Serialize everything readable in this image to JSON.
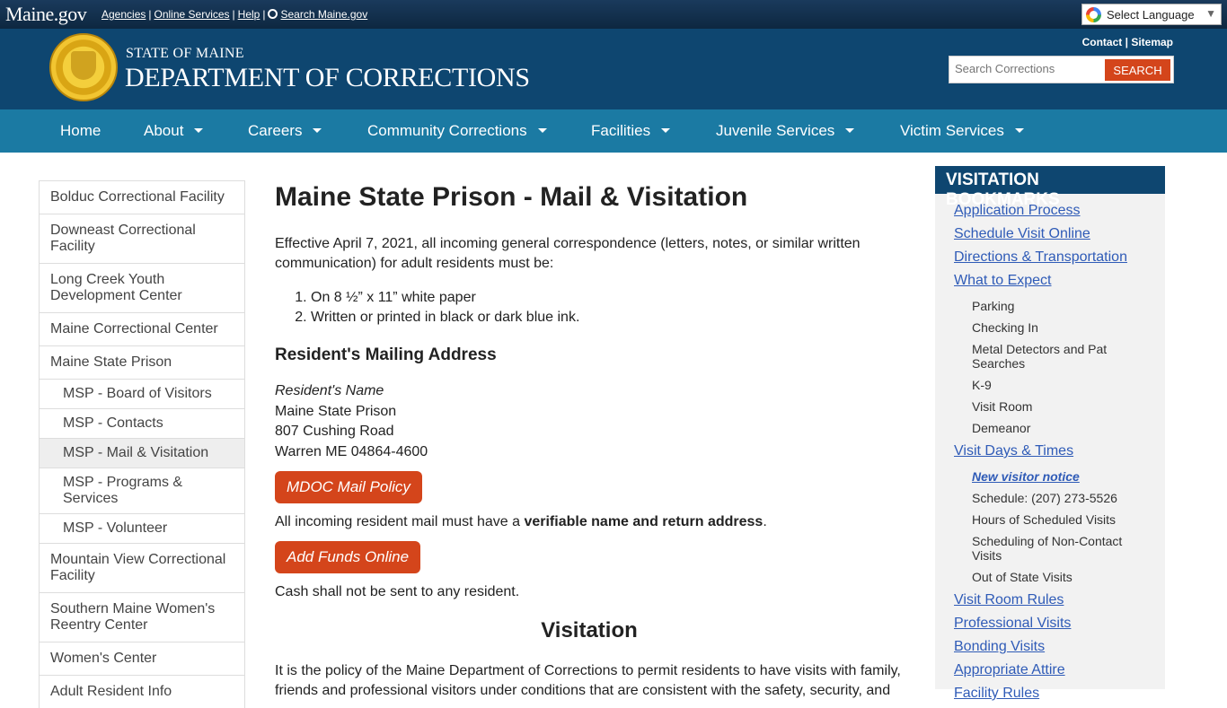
{
  "topbar": {
    "logo": "Maine.gov",
    "links": [
      "Agencies",
      "Online Services",
      "Help"
    ],
    "search_link": "Search Maine.gov",
    "language": "Select Language"
  },
  "header": {
    "state": "STATE OF MAINE",
    "department": "DEPARTMENT OF CORRECTIONS",
    "contact": "Contact",
    "sitemap": "Sitemap",
    "search_placeholder": "Search Corrections",
    "search_button": "SEARCH"
  },
  "nav": [
    "Home",
    "About",
    "Careers",
    "Community Corrections",
    "Facilities",
    "Juvenile Services",
    "Victim Services"
  ],
  "left_menu": [
    "Bolduc Correctional Facility",
    "Downeast Correctional Facility",
    "Long Creek Youth Development Center",
    "Maine Correctional Center",
    "Maine State Prison",
    "MSP - Board of Visitors",
    "MSP - Contacts",
    "MSP - Mail & Visitation",
    "MSP - Programs & Services",
    "MSP - Volunteer",
    "Mountain View Correctional Facility",
    "Southern Maine Women's Reentry Center",
    "Women's Center",
    "Adult Resident Info"
  ],
  "main": {
    "title": "Maine State Prison - Mail & Visitation",
    "intro": "Effective April 7, 2021, all incoming general correspondence (letters, notes, or similar written communication) for adult residents must be:",
    "rules": [
      "On 8 ½” x 11” white paper",
      "Written or printed in black or dark blue ink."
    ],
    "address_heading": "Resident's Mailing Address",
    "address": [
      "Resident's Name",
      "Maine State Prison",
      "807 Cushing Road",
      "Warren ME 04864-4600"
    ],
    "mail_policy_button": "MDOC Mail Policy",
    "mail_note_prefix": "All incoming resident mail must have a ",
    "mail_note_bold": "verifiable name and return address",
    "mail_note_suffix": ".",
    "funds_button": "Add Funds Online",
    "cash_note": "Cash shall not be sent to any resident.",
    "visitation_heading": "Visitation",
    "visitation_text": "It is the policy of the Maine Department of Corrections to permit residents to have visits with family, friends and professional visitors under conditions that are consistent with the safety, security, and"
  },
  "bookmarks": {
    "title": "VISITATION BOOKMARKS",
    "application_process": "Application Process",
    "schedule_visit": "Schedule Visit Online",
    "directions": "Directions & Transportation",
    "what_to_expect": "What to Expect",
    "expect_items": [
      "Parking",
      "Checking In",
      "Metal Detectors and Pat Searches",
      "K-9",
      "Visit Room",
      "Demeanor"
    ],
    "visit_days": "Visit Days & Times",
    "new_visitor_notice": "New visitor notice",
    "days_items": [
      "Schedule: (207) 273-5526",
      "Hours of Scheduled Visits",
      "Scheduling of Non-Contact Visits",
      "Out of State Visits"
    ],
    "visit_room_rules": "Visit Room Rules",
    "professional_visits": "Professional Visits",
    "bonding_visits": "Bonding Visits",
    "appropriate_attire": "Appropriate Attire",
    "facility_rules": "Facility Rules"
  }
}
